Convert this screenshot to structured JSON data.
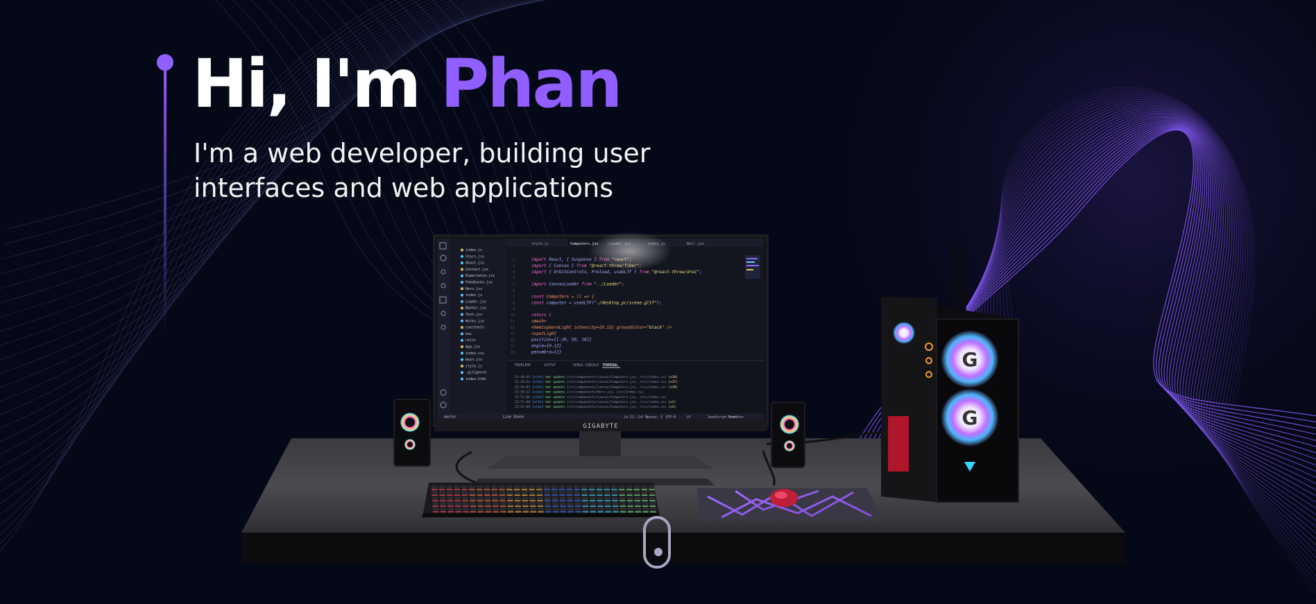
{
  "hero": {
    "greeting": "Hi, I'm ",
    "name": "Phan",
    "subtitle": "I'm a web developer, building user interfaces and web applications"
  },
  "colors": {
    "background": "#050816",
    "accent": "#915EFF",
    "text": "#ffffff",
    "secondary": "#aaa6c3"
  },
  "monitor": {
    "brand": "GIGABYTE",
    "editor": {
      "tabs": [
        "style.js",
        "Computers.jsx",
        "Loader.jsx",
        "index.js",
        "Ball.jsx"
      ],
      "explorer_items": [
        "index.js",
        "Stars.jsx",
        "About.jsx",
        "Contact.jsx",
        "Experience.jsx",
        "Feedbacks.jsx",
        "Hero.jsx",
        "index.js",
        "Loader.jsx",
        "Navbar.jsx",
        "Tech.jsx",
        "Works.jsx",
        "constants",
        "hoc",
        "utils",
        "App.jsx",
        "index.css",
        "main.jsx",
        "style.js",
        ".gitignore",
        "index.html"
      ],
      "code_lines": [
        "import React, { Suspense } from \"react\";",
        "import { Canvas } from \"@react-three/fiber\";",
        "import { OrbitControls, Preload, useGLTF } from \"@react-three/drei\";",
        "",
        "import CanvasLoader from \"../Loader\";",
        "",
        "const Computers = () => {",
        "  const computer = useGLTF(\"./desktop_pc/scene.gltf\");",
        "",
        "  return (",
        "    <mesh>",
        "      <hemisphereLight intensity={0.15} groundColor=\"black\" />",
        "      <spotLight",
        "        position={[-20, 50, 10]}",
        "        angle={0.12}",
        "        penumbra={1}"
      ],
      "panel_tabs": [
        "PROBLEMS",
        "OUTPUT",
        "DEBUG CONSOLE",
        "TERMINAL"
      ],
      "terminal_lines": [
        "22:48:45 [vite] hmr update /src/components/canvas/Computers.jsx, /src/index.css (x39)",
        "22:48:51 [vite] hmr update /src/components/canvas/Computers.jsx, /src/index.css (x37)",
        "22:50:02 [vite] hmr update /src/components/canvas/Computers.jsx, /src/index.css (x38)",
        "22:50:12 [vite] hmr update /src/components/Hero.jsx, /src/index.css",
        "22:52:06 [vite] hmr update /src/components/canvas/Computers.jsx, /src/index.css",
        "22:52:08 [vite] hmr update /src/components/canvas/Computers.jsx, /src/index.css (x2)",
        "22:52:09 [vite] hmr update /src/components/canvas/Computers.jsx, /src/index.css (x3)"
      ],
      "status_left": "master",
      "status_live": "Live Share",
      "status_right": [
        "Ln 12, Col 1",
        "Spaces: 2",
        "UTF-8",
        "LF",
        "JavaScript React",
        "Prettier"
      ]
    }
  }
}
